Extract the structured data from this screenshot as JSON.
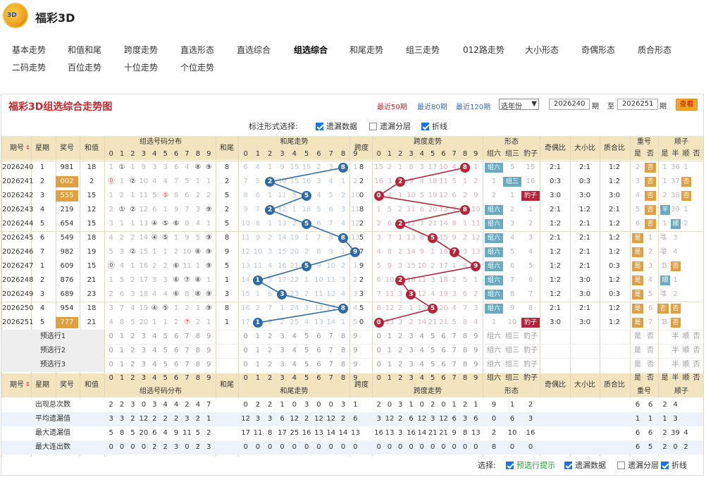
{
  "site": {
    "title": "福彩3D",
    "logo_text": "3D"
  },
  "nav": [
    {
      "label": "基本走势"
    },
    {
      "label": "和值和尾"
    },
    {
      "label": "跨度走势"
    },
    {
      "label": "直选形态"
    },
    {
      "label": "直选综合"
    },
    {
      "label": "组选综合",
      "active": true
    },
    {
      "label": "和尾走势"
    },
    {
      "label": "组三走势"
    },
    {
      "label": "012路走势"
    },
    {
      "label": "大小形态"
    },
    {
      "label": "奇偶形态"
    },
    {
      "label": "质合形态"
    },
    {
      "label": "二码走势"
    },
    {
      "label": "百位走势"
    },
    {
      "label": "十位走势"
    },
    {
      "label": "个位走势"
    }
  ],
  "panel": {
    "title": "福彩3D组选综合走势图",
    "links": [
      {
        "label": "最近50期",
        "color": "#c0282e"
      },
      {
        "label": "最近80期",
        "color": "#3a6ab0"
      },
      {
        "label": "最近120期",
        "color": "#3a6ab0"
      }
    ],
    "select": "选年份",
    "from": "2026240",
    "to": "2026251",
    "qi": "期",
    "zhi": "至",
    "query": "查看"
  },
  "options": {
    "label": "标注形式选择:",
    "items": [
      {
        "label": "遗漏数据",
        "checked": true
      },
      {
        "label": "遗漏分层",
        "checked": false
      },
      {
        "label": "折线",
        "checked": true
      }
    ]
  },
  "headers": {
    "period": "期号",
    "week": "星期",
    "num": "奖号",
    "sum": "和值",
    "group": "组选号码分布",
    "tail": "和尾",
    "tail_trend": "和尾走势",
    "span": "跨度",
    "span_trend": "跨度走势",
    "shape": "形态",
    "g6": "组六",
    "g3": "组三",
    "bz": "豹子",
    "oe": "奇偶比",
    "bs": "大小比",
    "pc": "质合比",
    "dup": "重号",
    "yes": "是",
    "no": "否",
    "seq": "顺子",
    "half": "半",
    "shun": "顺"
  },
  "digits": [
    "0",
    "1",
    "2",
    "3",
    "4",
    "5",
    "6",
    "7",
    "8",
    "9"
  ],
  "rows": [
    {
      "p": "2026240",
      "w": "1",
      "n": "981",
      "s": "18",
      "g": [
        "1",
        "①",
        "1",
        "9",
        "3",
        "3",
        "6",
        "4",
        "⑧",
        "⑨"
      ],
      "t": "8",
      "tr": [
        "6",
        "4",
        "1",
        "9",
        "15",
        "15",
        "2",
        "3",
        "8",
        "1"
      ],
      "sp": "8",
      "spr": [
        "15",
        "2",
        "1",
        "8",
        "3",
        "17",
        "10",
        "4",
        "8",
        "1"
      ],
      "shp": "g6",
      "sv": [
        "组六",
        "5",
        "15"
      ],
      "oe": "2:1",
      "bs": "2:1",
      "pc": "1:2",
      "dup": [
        "2",
        "否"
      ],
      "seq": [
        "1",
        "36",
        "1"
      ]
    },
    {
      "p": "2026241",
      "w": "2",
      "n": "002",
      "s": "2",
      "g": [
        "⓪",
        "1",
        "②",
        "10",
        "4",
        "4",
        "7",
        "5",
        "1",
        "1"
      ],
      "t": "2",
      "tr": [
        "7",
        "5",
        "2",
        "10",
        "15",
        "16",
        "3",
        "4",
        "1",
        "2"
      ],
      "sp": "2",
      "spr": [
        "16",
        "3",
        "2",
        "9",
        "4",
        "18",
        "11",
        "5",
        "1",
        "2"
      ],
      "shp": "g3",
      "sv": [
        "1",
        "组三",
        "16"
      ],
      "oe": "0:3",
      "bs": "0:3",
      "pc": "1:2",
      "dup": [
        "3",
        "否"
      ],
      "seq": [
        "1",
        "37",
        "否"
      ]
    },
    {
      "p": "2026242",
      "w": "3",
      "n": "555",
      "s": "15",
      "g": [
        "1",
        "2",
        "1",
        "11",
        "5",
        "⑤",
        "8",
        "6",
        "2",
        "2"
      ],
      "t": "5",
      "tr": [
        "8",
        "6",
        "1",
        "11",
        "5",
        "17",
        "4",
        "5",
        "2",
        "10"
      ],
      "sp": "0",
      "spr": [
        "0",
        "4",
        "1",
        "10",
        "5",
        "19",
        "12",
        "6",
        "2",
        "9"
      ],
      "shp": "bz",
      "sv": [
        "2",
        "1",
        "豹子"
      ],
      "oe": "3:0",
      "bs": "3:0",
      "pc": "3:0",
      "dup": [
        "4",
        "否"
      ],
      "seq": [
        "2",
        "38",
        "否"
      ]
    },
    {
      "p": "2026243",
      "w": "4",
      "n": "219",
      "s": "12",
      "g": [
        "2",
        "①",
        "②",
        "12",
        "6",
        "1",
        "9",
        "7",
        "3",
        "⑨"
      ],
      "t": "2",
      "tr": [
        "9",
        "7",
        "2",
        "12",
        "1",
        "18",
        "5",
        "6",
        "3",
        "11"
      ],
      "sp": "8",
      "spr": [
        "1",
        "5",
        "2",
        "11",
        "6",
        "20",
        "13",
        "7",
        "8",
        "10"
      ],
      "shp": "g6",
      "sv": [
        "组六",
        "2",
        "1"
      ],
      "oe": "2:1",
      "bs": "1:2",
      "pc": "2:1",
      "dup": [
        "5",
        "否"
      ],
      "seq": [
        "半",
        "39",
        "1"
      ]
    },
    {
      "p": "2026244",
      "w": "5",
      "n": "654",
      "s": "15",
      "g": [
        "3",
        "1",
        "1",
        "13",
        "④",
        "⑤",
        "⑥",
        "8",
        "4",
        "1"
      ],
      "t": "5",
      "tr": [
        "10",
        "8",
        "1",
        "13",
        "2",
        "5",
        "6",
        "7",
        "4",
        "12"
      ],
      "sp": "2",
      "spr": [
        "2",
        "6",
        "2",
        "12",
        "7",
        "21",
        "14",
        "8",
        "1",
        "11"
      ],
      "shp": "g6",
      "sv": [
        "组六",
        "3",
        "2"
      ],
      "oe": "1:2",
      "bs": "2:1",
      "pc": "1:2",
      "dup": [
        "6",
        "否"
      ],
      "seq": [
        "1",
        "顺",
        "2"
      ]
    },
    {
      "p": "2026245",
      "w": "6",
      "n": "549",
      "s": "18",
      "g": [
        "4",
        "2",
        "2",
        "14",
        "④",
        "⑤",
        "1",
        "9",
        "5",
        "⑨"
      ],
      "t": "8",
      "tr": [
        "11",
        "9",
        "2",
        "14",
        "19",
        "1",
        "7",
        "8",
        "8",
        "13"
      ],
      "sp": "5",
      "spr": [
        "3",
        "7",
        "1",
        "13",
        "8",
        "5",
        "15",
        "9",
        "2",
        "12"
      ],
      "shp": "g6",
      "sv": [
        "组六",
        "4",
        "3"
      ],
      "oe": "2:1",
      "bs": "2:1",
      "pc": "1:2",
      "dup": [
        "是",
        "1",
        "半"
      ],
      "seq": [
        "1",
        "3"
      ]
    },
    {
      "p": "2026246",
      "w": "7",
      "n": "982",
      "s": "19",
      "g": [
        "5",
        "3",
        "②",
        "15",
        "1",
        "1",
        "2",
        "10",
        "⑧",
        "⑨"
      ],
      "t": "9",
      "tr": [
        "12",
        "10",
        "3",
        "15",
        "20",
        "2",
        "8",
        "9",
        "1",
        "9"
      ],
      "sp": "7",
      "spr": [
        "4",
        "8",
        "2",
        "14",
        "9",
        "1",
        "16",
        "7",
        "3",
        "13"
      ],
      "shp": "g6",
      "sv": [
        "组六",
        "5",
        "4"
      ],
      "oe": "1:2",
      "bs": "2:1",
      "pc": "1:2",
      "dup": [
        "是",
        "2",
        "半"
      ],
      "seq": [
        "2",
        "4"
      ]
    },
    {
      "p": "2026247",
      "w": "1",
      "n": "609",
      "s": "15",
      "g": [
        "⓪",
        "4",
        "1",
        "16",
        "2",
        "2",
        "⑥",
        "11",
        "1",
        "⑨"
      ],
      "t": "5",
      "tr": [
        "13",
        "11",
        "4",
        "16",
        "21",
        "5",
        "9",
        "10",
        "2",
        "1"
      ],
      "sp": "9",
      "spr": [
        "5",
        "9",
        "3",
        "15",
        "10",
        "2",
        "17",
        "1",
        "4",
        "9"
      ],
      "shp": "g6",
      "sv": [
        "组六",
        "6",
        "5"
      ],
      "oe": "1:2",
      "bs": "2:1",
      "pc": "0:3",
      "dup": [
        "是",
        "3",
        "1"
      ],
      "seq": [
        "3",
        "否"
      ]
    },
    {
      "p": "2026248",
      "w": "2",
      "n": "876",
      "s": "21",
      "g": [
        "1",
        "5",
        "2",
        "17",
        "3",
        "3",
        "⑥",
        "⑦",
        "⑧",
        "1"
      ],
      "t": "1",
      "tr": [
        "14",
        "1",
        "5",
        "17",
        "22",
        "1",
        "10",
        "11",
        "3",
        "2"
      ],
      "sp": "2",
      "spr": [
        "6",
        "10",
        "2",
        "16",
        "11",
        "3",
        "18",
        "2",
        "5",
        "1"
      ],
      "shp": "g6",
      "sv": [
        "组六",
        "7",
        "6"
      ],
      "oe": "1:2",
      "bs": "3:0",
      "pc": "1:2",
      "dup": [
        "是",
        "4",
        "2"
      ],
      "seq": [
        "顺",
        "1"
      ]
    },
    {
      "p": "2026249",
      "w": "3",
      "n": "689",
      "s": "23",
      "g": [
        "2",
        "6",
        "3",
        "18",
        "4",
        "4",
        "⑥",
        "8",
        "⑧",
        "⑨"
      ],
      "t": "3",
      "tr": [
        "15",
        "1",
        "6",
        "3",
        "23",
        "2",
        "11",
        "12",
        "4",
        "3"
      ],
      "sp": "3",
      "spr": [
        "7",
        "11",
        "3",
        "3",
        "12",
        "4",
        "19",
        "3",
        "6",
        "2"
      ],
      "shp": "g6",
      "sv": [
        "组六",
        "8",
        "7"
      ],
      "oe": "1:2",
      "bs": "3:0",
      "pc": "0:3",
      "dup": [
        "是",
        "5",
        "半"
      ],
      "seq": [
        "1",
        "2"
      ]
    },
    {
      "p": "2026250",
      "w": "4",
      "n": "954",
      "s": "18",
      "g": [
        "3",
        "7",
        "4",
        "19",
        "④",
        "⑤",
        "1",
        "2",
        "1",
        "⑨"
      ],
      "t": "8",
      "tr": [
        "16",
        "2",
        "7",
        "1",
        "24",
        "3",
        "12",
        "13",
        "8",
        "4"
      ],
      "sp": "5",
      "spr": [
        "8",
        "12",
        "2",
        "1",
        "13",
        "5",
        "20",
        "4",
        "7",
        "3"
      ],
      "shp": "g6",
      "sv": [
        "组六",
        "9",
        "8"
      ],
      "oe": "2:1",
      "bs": "2:1",
      "pc": "1:2",
      "dup": [
        "是",
        "6",
        "否"
      ],
      "seq": [
        "1",
        "否"
      ]
    },
    {
      "p": "2026251",
      "w": "5",
      "n": "777",
      "s": "21",
      "g": [
        "4",
        "8",
        "5",
        "20",
        "1",
        "1",
        "2",
        "⑦",
        "2",
        "1"
      ],
      "t": "1",
      "tr": [
        "17",
        "1",
        "8",
        "2",
        "25",
        "4",
        "13",
        "14",
        "1",
        "5"
      ],
      "sp": "0",
      "spr": [
        "0",
        "13",
        "3",
        "2",
        "14",
        "21",
        "21",
        "5",
        "8",
        "4"
      ],
      "shp": "bz",
      "sv": [
        "1",
        "10",
        "豹子"
      ],
      "oe": "3:0",
      "bs": "3:0",
      "pc": "1:2",
      "dup": [
        "是",
        "7",
        "1"
      ],
      "seq": [
        "3",
        "否"
      ]
    }
  ],
  "predict": [
    "预选行1",
    "预选行2",
    "预选行3"
  ],
  "stats": [
    {
      "label": "出现总次数",
      "g": [
        "2",
        "2",
        "3",
        "0",
        "3",
        "4",
        "4",
        "2",
        "4",
        "7"
      ],
      "t": [
        "0",
        "2",
        "2",
        "1",
        "0",
        "3",
        "0",
        "0",
        "3",
        "1"
      ],
      "sp": [
        "2",
        "0",
        "3",
        "1",
        "0",
        "2",
        "0",
        "1",
        "2",
        "1"
      ],
      "sh": [
        "9",
        "1",
        "2"
      ],
      "dup": [
        "6",
        "6"
      ],
      "seq": [
        "2",
        "4"
      ]
    },
    {
      "label": "平均遗漏值",
      "g": [
        "3",
        "3",
        "2",
        "12",
        "2",
        "2",
        "2",
        "3",
        "2",
        "1"
      ],
      "t": [
        "12",
        "3",
        "3",
        "6",
        "12",
        "2",
        "12",
        "12",
        "2",
        "6"
      ],
      "sp": [
        "3",
        "12",
        "2",
        "6",
        "12",
        "3",
        "12",
        "6",
        "3",
        "6"
      ],
      "sh": [
        "0",
        "6",
        "3"
      ],
      "dup": [
        "1",
        "1"
      ],
      "seq": [
        "1",
        "3"
      ]
    },
    {
      "label": "最大遗漏值",
      "g": [
        "5",
        "8",
        "5",
        "20",
        "6",
        "4",
        "9",
        "11",
        "5",
        "2"
      ],
      "t": [
        "17",
        "11",
        "8",
        "17",
        "25",
        "16",
        "13",
        "14",
        "14",
        "13"
      ],
      "sp": [
        "16",
        "13",
        "3",
        "16",
        "14",
        "21",
        "21",
        "9",
        "8",
        "13"
      ],
      "sh": [
        "2",
        "10",
        "16"
      ],
      "dup": [
        "6",
        "6"
      ],
      "seq": [
        "2",
        "39",
        "4"
      ]
    },
    {
      "label": "最大连出数",
      "g": [
        "0",
        "0",
        "0",
        "0",
        "2",
        "2",
        "3",
        "0",
        "2",
        "3"
      ],
      "t": [
        "0",
        "0",
        "0",
        "0",
        "0",
        "0",
        "0",
        "0",
        "0",
        "0"
      ],
      "sp": [
        "0",
        "0",
        "0",
        "0",
        "0",
        "0",
        "0",
        "0",
        "0",
        "0"
      ],
      "sh": [
        "8",
        "0",
        "0"
      ],
      "dup": [
        "6",
        "5"
      ],
      "seq": [
        "2",
        "0",
        "2"
      ]
    }
  ],
  "footer": {
    "label": "选择:",
    "items": [
      {
        "label": "预选行提示",
        "checked": true,
        "color": "#2a9a3a"
      },
      {
        "label": "遗漏数据",
        "checked": true
      },
      {
        "label": "遗漏分层",
        "checked": false
      },
      {
        "label": "折线",
        "checked": true
      }
    ]
  },
  "colors": {
    "blue": "#2d6aa8",
    "red": "#b8233a",
    "orange": "#e0a040",
    "teal": "#6aa9c0",
    "title": "#c0282e"
  }
}
